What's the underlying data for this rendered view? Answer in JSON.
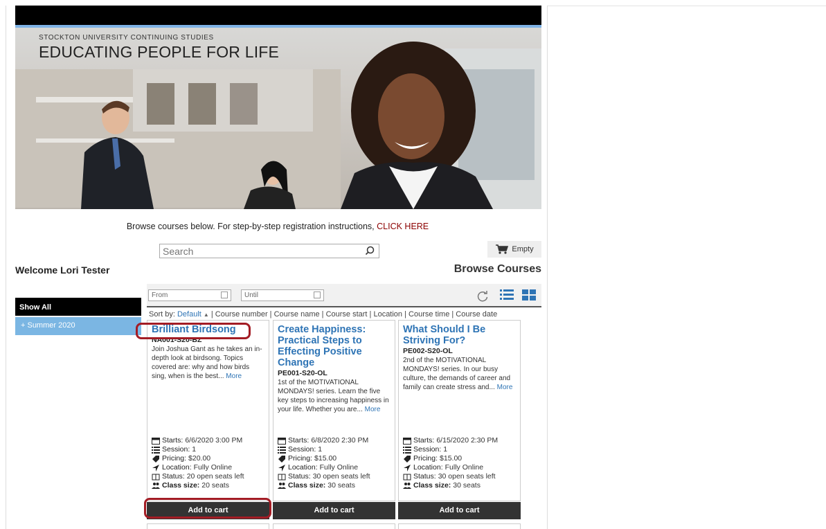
{
  "banner": {
    "small_title": "STOCKTON UNIVERSITY CONTINUING STUDIES",
    "big_title": "EDUCATING PEOPLE FOR LIFE"
  },
  "browse_line": {
    "text": "Browse courses below. For step-by-step registration instructions,",
    "link": "CLICK HERE"
  },
  "search": {
    "placeholder": "Search"
  },
  "cart": {
    "label": "Empty"
  },
  "welcome": "Welcome Lori Tester",
  "browse_title": "Browse Courses",
  "filters": {
    "from_placeholder": "From",
    "until_placeholder": "Until"
  },
  "sort": {
    "label": "Sort by:",
    "current": "Default",
    "options_text": "| Course number | Course name | Course start | Location | Course time | Course date"
  },
  "sidebar": {
    "show_all": "Show All",
    "items": [
      {
        "label": "+  Summer 2020"
      }
    ]
  },
  "card_labels": {
    "starts": "Starts:",
    "session": "Session:",
    "pricing": "Pricing:",
    "location": "Location:",
    "status": "Status:",
    "class_size": "Class size:",
    "more": "More",
    "add_to_cart": "Add to cart"
  },
  "courses": [
    {
      "title": "Brilliant Birdsong",
      "code": "NA001-S20-BZ",
      "desc": "Join Joshua Gant as he takes an in-depth look at birdsong. Topics covered are: why and how birds sing, when is the best...",
      "starts": "6/6/2020 3:00 PM",
      "session": "1",
      "pricing": "$20.00",
      "location": "Fully Online",
      "status": "20 open seats left",
      "class_size": "20 seats"
    },
    {
      "title": "Create Happiness: Practical Steps to Effecting Positive Change",
      "code": "PE001-S20-OL",
      "desc": "1st of the MOTIVATIONAL MONDAYS! series. Learn the five key steps to increasing happiness in your life. Whether you are...",
      "starts": "6/8/2020 2:30 PM",
      "session": "1",
      "pricing": "$15.00",
      "location": "Fully Online",
      "status": "30 open seats left",
      "class_size": "30 seats"
    },
    {
      "title": "What Should I Be Striving For?",
      "code": "PE002-S20-OL",
      "desc": "2nd of the MOTIVATIONAL MONDAYS! series. In our busy culture, the demands of career and family can create stress and...",
      "starts": "6/15/2020 2:30 PM",
      "session": "1",
      "pricing": "$15.00",
      "location": "Fully Online",
      "status": "30 open seats left",
      "class_size": "30 seats"
    }
  ],
  "colors": {
    "link_blue": "#2e74b5",
    "highlight_red": "#a31c24",
    "sidebar_blue": "#7bb6e3"
  }
}
